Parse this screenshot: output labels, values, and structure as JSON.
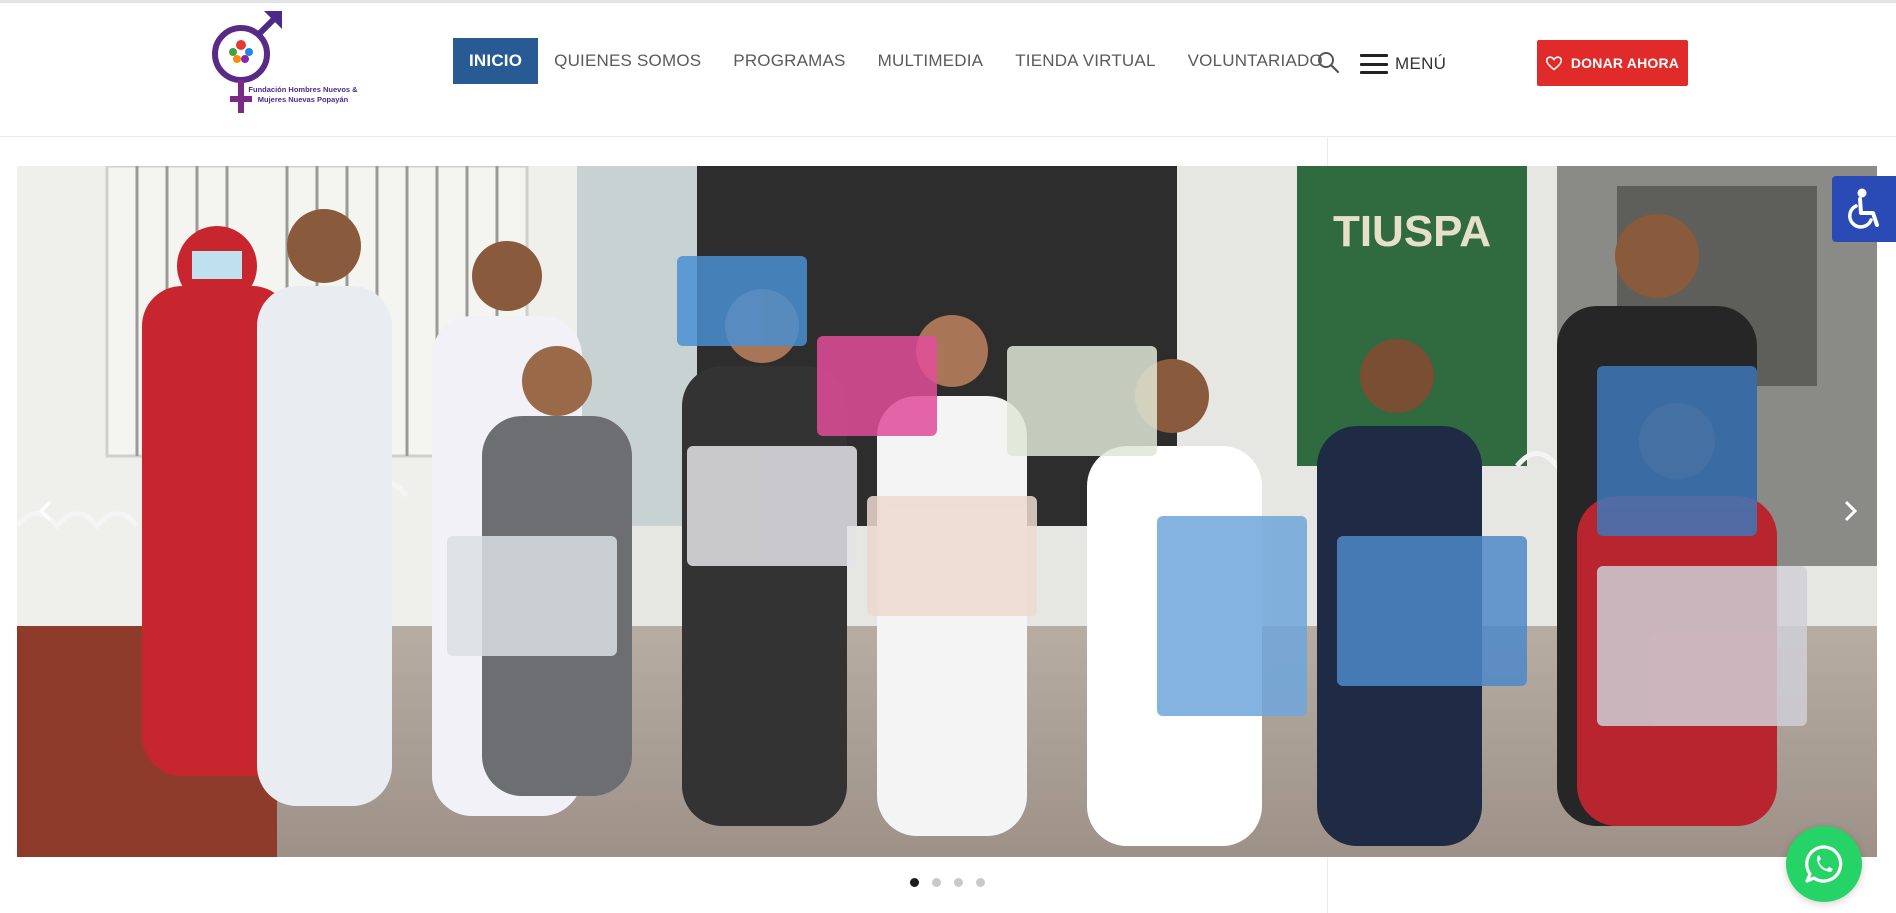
{
  "header": {
    "logo_text": "Fundación Hombres Nuevos & Mujeres Nuevas Popayán",
    "nav": [
      {
        "label": "INICIO",
        "active": true
      },
      {
        "label": "QUIENES SOMOS",
        "active": false
      },
      {
        "label": "PROGRAMAS",
        "active": false
      },
      {
        "label": "MULTIMEDIA",
        "active": false
      },
      {
        "label": "TIENDA VIRTUAL",
        "active": false
      },
      {
        "label": "VOLUNTARIADO",
        "active": false
      }
    ],
    "search_icon": "search-icon",
    "menu_label": "MENÚ",
    "donate_label": "DONAR AHORA",
    "donate_icon": "heart-icon"
  },
  "slider": {
    "banner_text": "TIUSPA",
    "slide_count": 4,
    "active_slide": 1,
    "prev_icon": "chevron-left-icon",
    "next_icon": "chevron-right-icon"
  },
  "widgets": {
    "accessibility_icon": "wheelchair-icon",
    "whatsapp_icon": "whatsapp-icon"
  },
  "colors": {
    "nav_active": "#285a94",
    "donate": "#e12b2b",
    "accessibility": "#2a4bb5",
    "whatsapp": "#25d366"
  }
}
